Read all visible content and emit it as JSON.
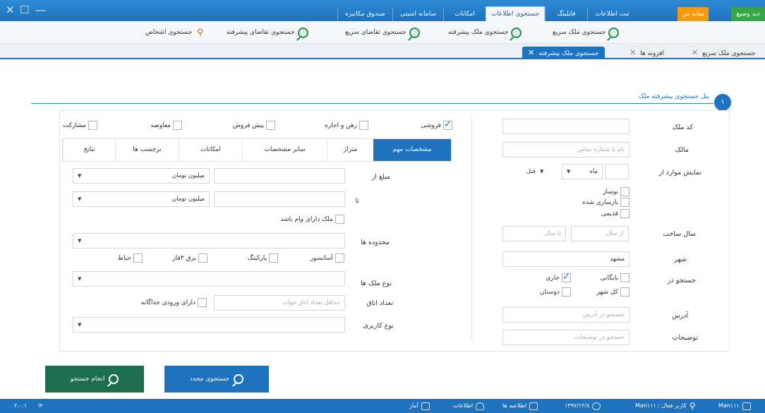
{
  "window": {
    "close": "✕",
    "maximize": "☐",
    "minimize": "—"
  },
  "menu_tabs": [
    {
      "label": "صندوق مکانیزه"
    },
    {
      "label": "سامانه امنیتی"
    },
    {
      "label": "امکانات"
    },
    {
      "label": "جستجوی اطلاعات"
    },
    {
      "label": "فایلینگ"
    },
    {
      "label": "ثبت اطلاعات"
    },
    {
      "label": "نمایه من"
    },
    {
      "label": "دید وسیع"
    }
  ],
  "sub_menu": [
    {
      "label": "جستجوی ملک سریع"
    },
    {
      "label": "جستجوی ملک پیشرفته"
    },
    {
      "label": "جستجوی تقاضای سریع"
    },
    {
      "label": "جستجوی تقاضای پیشرفته"
    },
    {
      "label": "جستجوی اشخاص"
    }
  ],
  "doc_tabs": [
    {
      "label": "جستجوی ملک پیشرفته"
    },
    {
      "label": "افزونه ها"
    },
    {
      "label": "جستجوی ملک سریع"
    }
  ],
  "tab_close": "✕",
  "panel": {
    "number": "۱",
    "title": "پنل جستجوی پیشرفته ملک"
  },
  "right": {
    "code_label": "کد ملک",
    "owner_label": "مالک",
    "owner_placeholder": "نام یا شماره تماس",
    "show_label": "نمایش موارد از",
    "unit_value": "ماه",
    "before_value": "قبل",
    "ages": [
      "نوساز",
      "بازسازی شده",
      "قدیمی"
    ],
    "year_label": "سال ساخت",
    "year_from": "از سال",
    "year_to": "تا سال",
    "city_label": "شهر",
    "city_value": "مشهد",
    "search_in_label": "جستجو در",
    "search_in": [
      "جاری",
      "بایگانی",
      "کل شهر",
      "دوستان"
    ],
    "address_label": "آدرس",
    "address_placeholder": "جستجو در آدرس",
    "desc_label": "توضیحات",
    "desc_placeholder": "جستجو در توضیحات"
  },
  "deal_types": [
    {
      "label": "فروشی",
      "checked": true
    },
    {
      "label": "رهن و اجاره",
      "checked": false
    },
    {
      "label": "پیش فروش",
      "checked": false
    },
    {
      "label": "معاوضه",
      "checked": false
    },
    {
      "label": "مشارکت",
      "checked": false
    }
  ],
  "form_tabs": [
    "مشخصات مهم",
    "متراژ",
    "سایر مشخصات",
    "امکانات",
    "برچسب ها",
    "نتایج"
  ],
  "left": {
    "amount_from_label": "مبلغ از",
    "to_label": "تا",
    "currency": "میلیون تومان",
    "loan_label": "ملک دارای وام باشد",
    "area_label": "محدوده ها",
    "amenities": [
      "آسانسور",
      "پارکینگ",
      "برق ۳فاز",
      "حیاط"
    ],
    "type_label": "نوع ملک ها",
    "rooms_label": "تعداد اتاق",
    "rooms_placeholder": "حداقل تعداد اتاق خواب",
    "separate_entry_label": "دارای ورودی جداگانه",
    "usage_label": "نوع کاربری"
  },
  "buttons": {
    "search": "انجام جستجو",
    "new_search": "جستجوی مجدد"
  },
  "status": {
    "version": "۲.۰.۱",
    "archive": "آمار",
    "info": "اطلاعات",
    "notices": "اطلاعیه ها",
    "date": "۱۳۹۷/۱۲/۸",
    "user": "Man۱۱۱ : کاربر فعال",
    "office": "Man۱۱۱"
  }
}
